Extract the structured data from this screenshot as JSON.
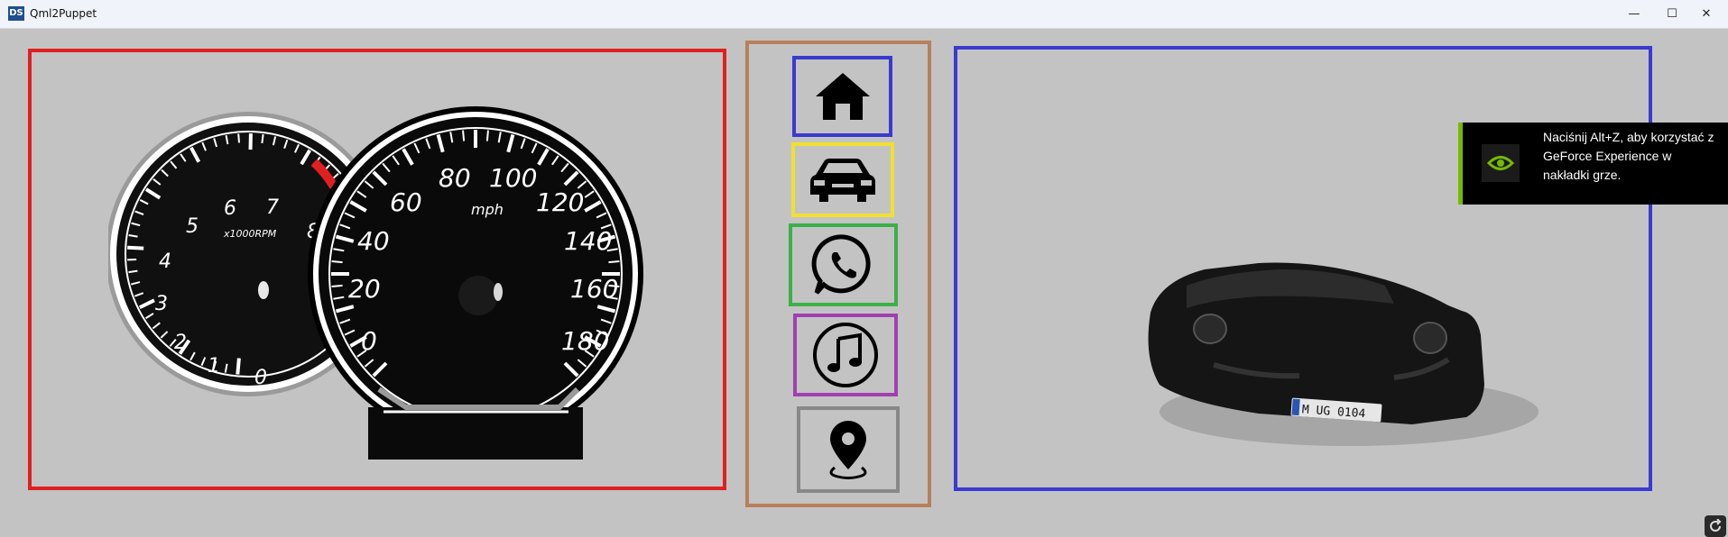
{
  "window": {
    "app_icon_text": "DS",
    "title": "Qml2Puppet",
    "minimize_label": "—",
    "maximize_label": "☐",
    "close_label": "✕"
  },
  "dashboard": {
    "tachometer": {
      "unit": "x1000RPM",
      "ticks": [
        "0",
        "1",
        "2",
        "3",
        "4",
        "5",
        "6",
        "7",
        "8"
      ]
    },
    "speedometer": {
      "unit": "mph",
      "ticks": [
        "0",
        "20",
        "40",
        "60",
        "80",
        "100",
        "120",
        "140",
        "160",
        "180"
      ]
    }
  },
  "nav": {
    "items": [
      {
        "name": "home",
        "icon": "home-icon"
      },
      {
        "name": "car",
        "icon": "car-icon"
      },
      {
        "name": "phone",
        "icon": "whatsapp-phone-icon"
      },
      {
        "name": "music",
        "icon": "music-note-icon"
      },
      {
        "name": "navigation",
        "icon": "map-pin-icon"
      }
    ]
  },
  "vehicle": {
    "license_plate": "M UG 0104"
  },
  "overlay": {
    "message": "Naciśnij Alt+Z, aby korzystać z GeForce Experience w nakładki grze."
  },
  "colors": {
    "gauge_frame": "#e02020",
    "nav_frame": "#b8805a",
    "car_frame": "#3a3ad0",
    "home_btn": "#3a3ad0",
    "car_btn": "#f2e030",
    "phone_btn": "#3cb048",
    "music_btn": "#a040b0",
    "nav_btn": "#888888",
    "nvidia_green": "#76b900"
  }
}
